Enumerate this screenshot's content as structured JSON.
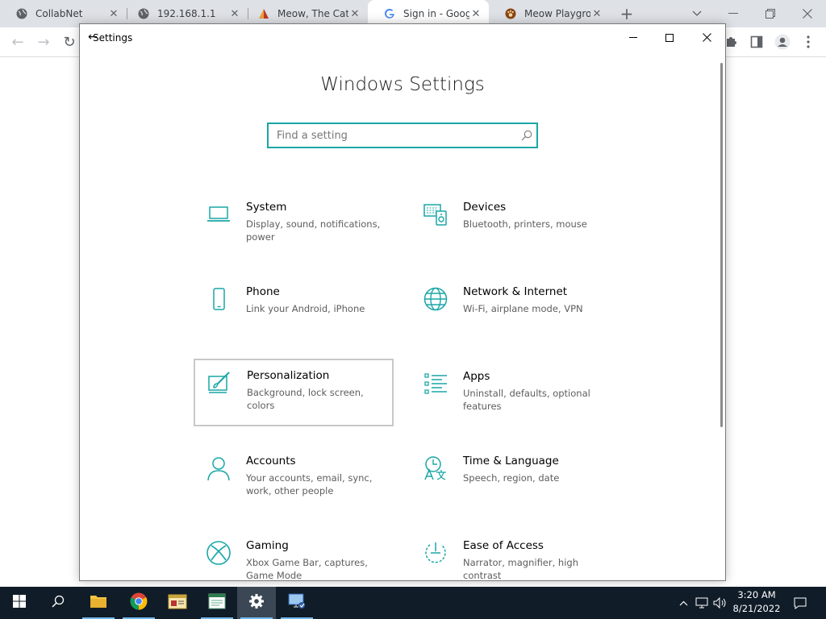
{
  "browser": {
    "tabs": [
      {
        "title": "CollabNet"
      },
      {
        "title": "192.168.1.1"
      },
      {
        "title": "Meow, The Cat"
      },
      {
        "title": "Sign in - Google"
      },
      {
        "title": "Meow Playground"
      }
    ],
    "new_tab_label": "+"
  },
  "settings": {
    "window_title": "Settings",
    "heading": "Windows Settings",
    "search": {
      "placeholder": "Find a setting",
      "value": ""
    },
    "tiles": [
      {
        "name": "System",
        "desc": "Display, sound, notifications, power",
        "icon": "laptop-icon"
      },
      {
        "name": "Devices",
        "desc": "Bluetooth, printers, mouse",
        "icon": "devices-icon"
      },
      {
        "name": "Phone",
        "desc": "Link your Android, iPhone",
        "icon": "phone-icon"
      },
      {
        "name": "Network & Internet",
        "desc": "Wi-Fi, airplane mode, VPN",
        "icon": "globe-icon"
      },
      {
        "name": "Personalization",
        "desc": "Background, lock screen, colors",
        "icon": "paintbrush-icon"
      },
      {
        "name": "Apps",
        "desc": "Uninstall, defaults, optional features",
        "icon": "apps-list-icon"
      },
      {
        "name": "Accounts",
        "desc": "Your accounts, email, sync, work, other people",
        "icon": "person-icon"
      },
      {
        "name": "Time & Language",
        "desc": "Speech, region, date",
        "icon": "time-language-icon"
      },
      {
        "name": "Gaming",
        "desc": "Xbox Game Bar, captures, Game Mode",
        "icon": "xbox-icon"
      },
      {
        "name": "Ease of Access",
        "desc": "Narrator, magnifier, high contrast",
        "icon": "ease-of-access-icon"
      }
    ],
    "selected_tile": "Personalization"
  },
  "taskbar": {
    "apps": [
      "start-button",
      "search-button",
      "file-explorer",
      "chrome",
      "app-window",
      "notepad-app",
      "settings",
      "remote-desktop"
    ],
    "clock": {
      "time": "3:20 AM",
      "date": "8/21/2022"
    }
  },
  "colors": {
    "accent": "#1aa6a6",
    "taskbar": "#101c28",
    "tabstrip": "#dee1e6"
  }
}
